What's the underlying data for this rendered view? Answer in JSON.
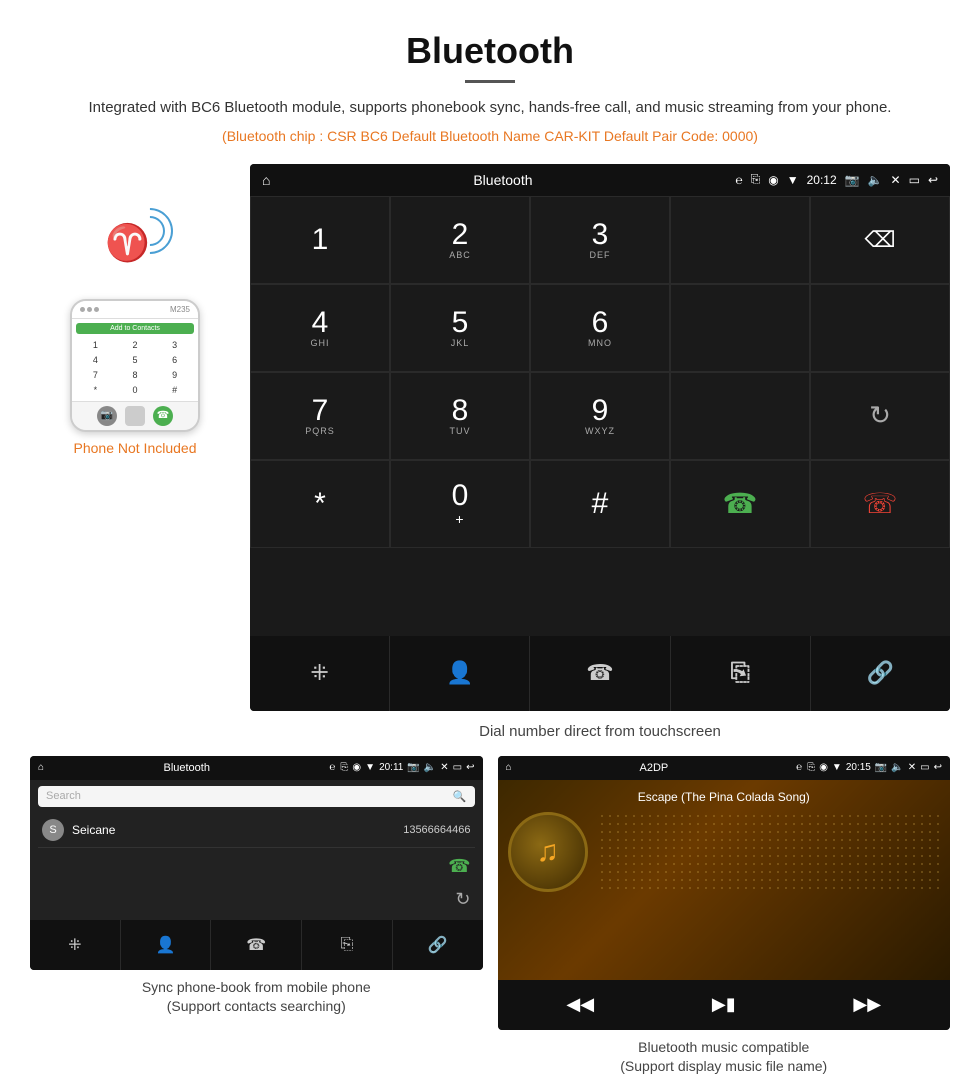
{
  "header": {
    "title": "Bluetooth",
    "subtitle": "Integrated with BC6 Bluetooth module, supports phonebook sync, hands-free call, and music streaming from your phone.",
    "orange_info": "(Bluetooth chip : CSR BC6    Default Bluetooth Name CAR-KIT    Default Pair Code: 0000)"
  },
  "phone_side": {
    "not_included": "Phone Not Included",
    "add_contacts": "Add to Contacts",
    "keys": [
      "1",
      "2",
      "3",
      "4",
      "5",
      "6",
      "7",
      "8",
      "9",
      "*",
      "0",
      "#"
    ]
  },
  "main_screen": {
    "status_bar": {
      "title": "Bluetooth",
      "time": "20:12"
    },
    "dialpad": [
      {
        "main": "1",
        "sub": ""
      },
      {
        "main": "2",
        "sub": "ABC"
      },
      {
        "main": "3",
        "sub": "DEF"
      },
      {
        "main": "",
        "sub": ""
      },
      {
        "main": "⌫",
        "sub": ""
      },
      {
        "main": "4",
        "sub": "GHI"
      },
      {
        "main": "5",
        "sub": "JKL"
      },
      {
        "main": "6",
        "sub": "MNO"
      },
      {
        "main": "",
        "sub": ""
      },
      {
        "main": "",
        "sub": ""
      },
      {
        "main": "7",
        "sub": "PQRS"
      },
      {
        "main": "8",
        "sub": "TUV"
      },
      {
        "main": "9",
        "sub": "WXYZ"
      },
      {
        "main": "",
        "sub": ""
      },
      {
        "main": "↻",
        "sub": ""
      },
      {
        "main": "*",
        "sub": ""
      },
      {
        "main": "0",
        "sub": "+"
      },
      {
        "main": "#",
        "sub": ""
      },
      {
        "main": "📞",
        "sub": ""
      },
      {
        "main": "📵",
        "sub": ""
      }
    ],
    "caption": "Dial number direct from touchscreen"
  },
  "phonebook_screen": {
    "status_bar": {
      "title": "Bluetooth",
      "time": "20:11"
    },
    "search_placeholder": "Search",
    "contacts": [
      {
        "initial": "S",
        "name": "Seicane",
        "number": "13566664466"
      }
    ],
    "caption_line1": "Sync phone-book from mobile phone",
    "caption_line2": "(Support contacts searching)"
  },
  "music_screen": {
    "status_bar": {
      "title": "A2DP",
      "time": "20:15"
    },
    "song_title": "Escape (The Pina Colada Song)",
    "caption_line1": "Bluetooth music compatible",
    "caption_line2": "(Support display music file name)"
  }
}
